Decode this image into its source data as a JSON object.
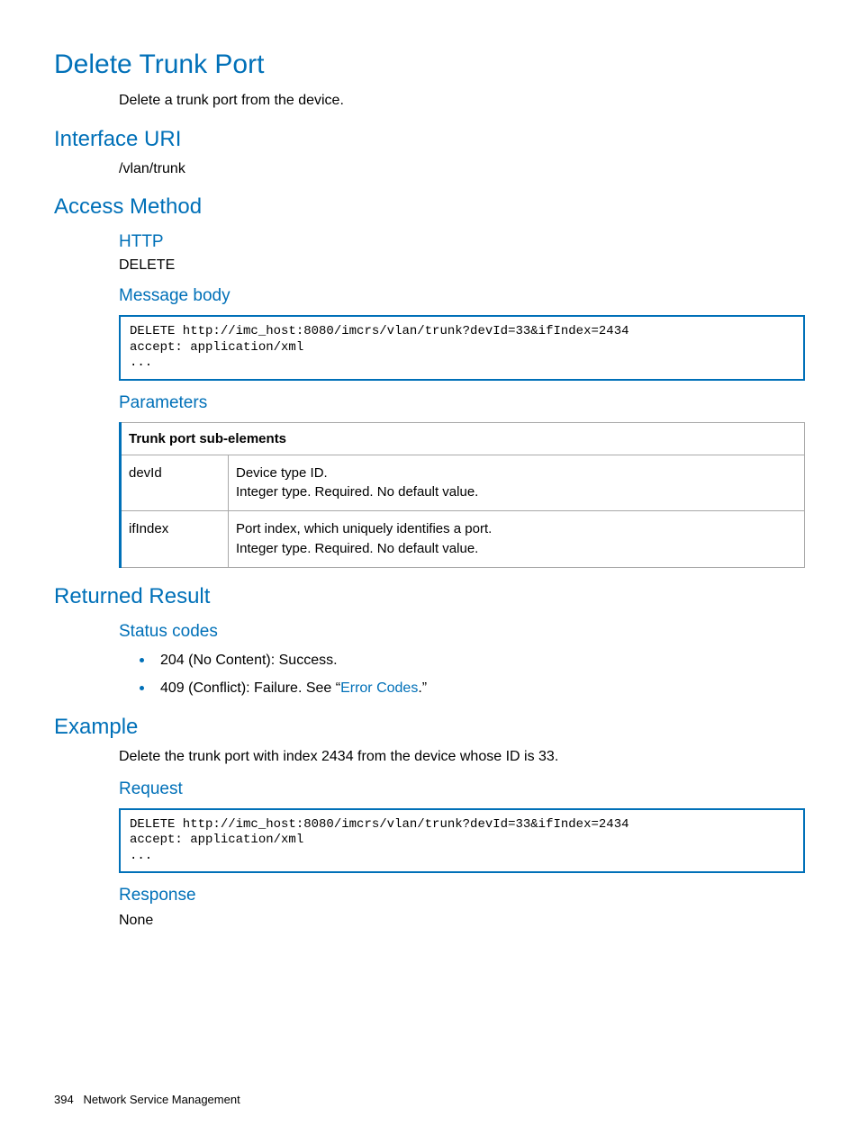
{
  "title": "Delete Trunk Port",
  "intro": "Delete a trunk port from the device.",
  "interface_uri": {
    "heading": "Interface URI",
    "value": "/vlan/trunk"
  },
  "access_method": {
    "heading": "Access Method",
    "http_label": "HTTP",
    "http_value": "DELETE",
    "message_body_label": "Message body",
    "message_body_code": "DELETE http://imc_host:8080/imcrs/vlan/trunk?devId=33&ifIndex=2434\naccept: application/xml\n...",
    "parameters_label": "Parameters",
    "param_table": {
      "header": "Trunk port sub-elements",
      "rows": [
        {
          "name": "devId",
          "desc": "Device type ID.\nInteger type. Required. No default value."
        },
        {
          "name": "ifIndex",
          "desc": "Port index, which uniquely identifies a port.\nInteger type. Required. No default value."
        }
      ]
    }
  },
  "returned_result": {
    "heading": "Returned Result",
    "status_codes_label": "Status codes",
    "items": [
      {
        "text_before": "204 (No Content): Success."
      },
      {
        "text_before": "409 (Conflict): Failure. See “",
        "link": "Error Codes",
        "text_after": ".”"
      }
    ]
  },
  "example": {
    "heading": "Example",
    "intro": "Delete the trunk port with index 2434 from the device whose ID is 33.",
    "request_label": "Request",
    "request_code": "DELETE http://imc_host:8080/imcrs/vlan/trunk?devId=33&ifIndex=2434\naccept: application/xml\n...",
    "response_label": "Response",
    "response_value": "None"
  },
  "footer": {
    "page_number": "394",
    "section": "Network Service Management"
  }
}
